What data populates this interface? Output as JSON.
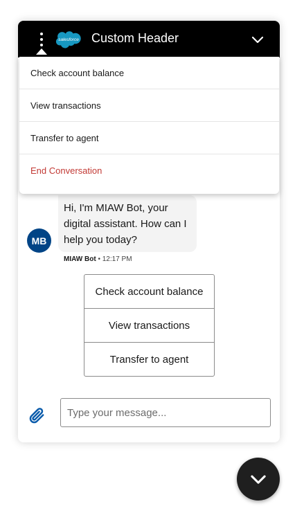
{
  "header": {
    "title": "Custom Header",
    "logo_text": "salesforce",
    "menu_icon": "kebab-menu-icon",
    "minimize_icon": "chevron-down-icon"
  },
  "menu": {
    "items": [
      {
        "label": "Check account balance"
      },
      {
        "label": "View transactions"
      },
      {
        "label": "Transfer to agent"
      },
      {
        "label": "End Conversation",
        "color": "#c23934"
      }
    ]
  },
  "conversation": {
    "bot_message": "Hi, I'm MIAW Bot, your digital assistant. How can I help you today?",
    "avatar_initials": "MB",
    "sender": "MIAW Bot",
    "time": "12:17 PM",
    "quick_replies": [
      {
        "label": "Check account balance"
      },
      {
        "label": "View transactions"
      },
      {
        "label": "Transfer to agent"
      }
    ]
  },
  "composer": {
    "placeholder": "Type your message...",
    "value": "",
    "attach_icon": "paperclip-icon"
  },
  "fab": {
    "icon": "chevron-down-icon"
  },
  "colors": {
    "header_bg": "#000000",
    "avatar_bg": "#014486",
    "attach": "#0b5cab",
    "danger": "#c23934",
    "logo": "#1798c1"
  }
}
